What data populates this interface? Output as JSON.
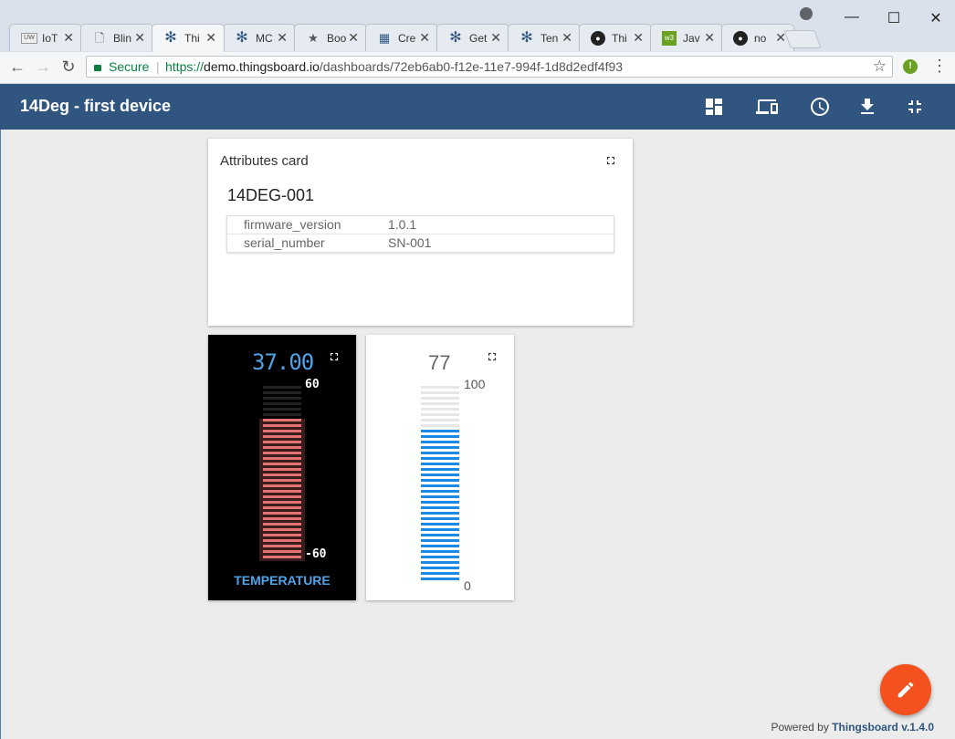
{
  "browser": {
    "tabs": [
      {
        "label": "IoT",
        "icon": "iot-favicon"
      },
      {
        "label": "Blin",
        "icon": "page-icon"
      },
      {
        "label": "Thi",
        "icon": "gear-favicon",
        "active": true
      },
      {
        "label": "MC",
        "icon": "gear-favicon"
      },
      {
        "label": "Boo",
        "icon": "star-favicon"
      },
      {
        "label": "Cre",
        "icon": "grid-favicon"
      },
      {
        "label": "Get",
        "icon": "gear-favicon"
      },
      {
        "label": "Ten",
        "icon": "gear-favicon"
      },
      {
        "label": "Thi",
        "icon": "github-icon"
      },
      {
        "label": "Jav",
        "icon": "w3-favicon"
      },
      {
        "label": "no",
        "icon": "github-icon"
      }
    ],
    "secure_label": "Secure",
    "url_scheme": "https://",
    "url_host": "demo.thingsboard.io",
    "url_path": "/dashboards/72eb6ab0-f12e-11e7-994f-1d8d2edf4f93",
    "extension_label": "!"
  },
  "dashboard": {
    "title": "14Deg - first device",
    "header_icons": [
      "dashboard-layout-icon",
      "devices-icon",
      "clock-icon",
      "download-icon",
      "fullscreen-exit-icon"
    ]
  },
  "attributes_card": {
    "title": "Attributes card",
    "device_name": "14DEG-001",
    "rows": [
      {
        "key": "firmware_version",
        "value": "1.0.1"
      },
      {
        "key": "serial_number",
        "value": "SN-001"
      }
    ]
  },
  "temperature_gauge": {
    "value_text": "37.00",
    "value": 37,
    "max_label": "60",
    "min_label": "-60",
    "max": 60,
    "min": -60,
    "label": "TEMPERATURE",
    "color": "#4fa3e8",
    "bar_color": "#e57373"
  },
  "level_gauge": {
    "value_text": "77",
    "value": 77,
    "max_label": "100",
    "min_label": "0",
    "max": 100,
    "min": 0,
    "bar_color": "#1e88e5"
  },
  "footer": {
    "powered_prefix": "Powered by",
    "brand": "Thingsboard",
    "version": "v.1.4.0"
  },
  "colors": {
    "header": "#305680",
    "fab": "#f4511e"
  }
}
